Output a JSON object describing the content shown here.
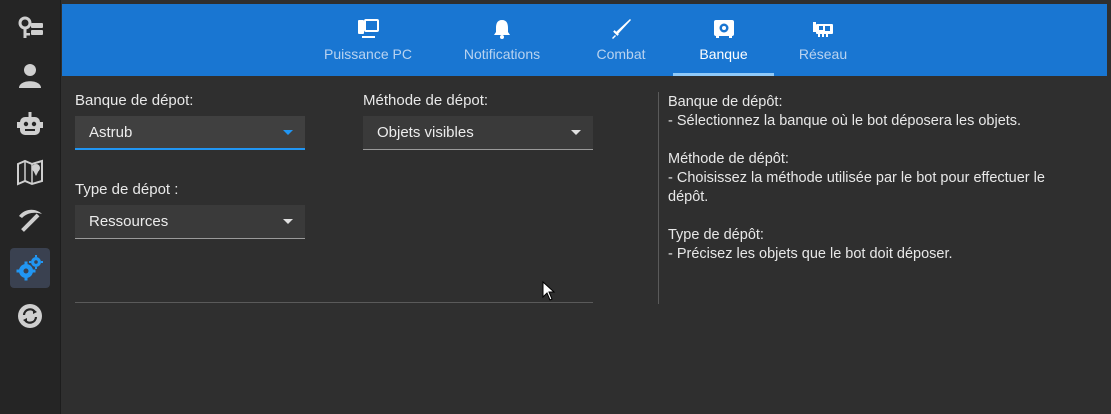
{
  "sidebar": {
    "items": [
      {
        "icon": "key-list-icon"
      },
      {
        "icon": "user-icon"
      },
      {
        "icon": "robot-icon"
      },
      {
        "icon": "map-pin-icon"
      },
      {
        "icon": "pickaxe-icon"
      },
      {
        "icon": "gears-icon",
        "active": true
      },
      {
        "icon": "sync-icon"
      }
    ]
  },
  "tabs": [
    {
      "label": "Puissance PC",
      "icon": "computer-icon"
    },
    {
      "label": "Notifications",
      "icon": "bell-icon"
    },
    {
      "label": "Combat",
      "icon": "sword-icon"
    },
    {
      "label": "Banque",
      "icon": "safe-icon",
      "active": true
    },
    {
      "label": "Réseau",
      "icon": "network-card-icon"
    }
  ],
  "form": {
    "bank_label": "Banque de dépot:",
    "bank_value": "Astrub",
    "method_label": "Méthode de dépot:",
    "method_value": "Objets visibles",
    "type_label": "Type de dépot :",
    "type_value": "Ressources"
  },
  "help": {
    "bank_title": "Banque de dépôt:",
    "bank_text": "- Sélectionnez la banque où le bot déposera les objets.",
    "method_title": "Méthode de dépôt:",
    "method_text": "- Choisissez la méthode utilisée par le bot pour effectuer le dépôt.",
    "type_title": "Type de dépôt:",
    "type_text": "- Précisez les objets que le bot doit déposer."
  },
  "colors": {
    "accent": "#1976d2",
    "focus": "#2196f3",
    "background": "#2f2f2f",
    "sidebar": "#252525"
  }
}
